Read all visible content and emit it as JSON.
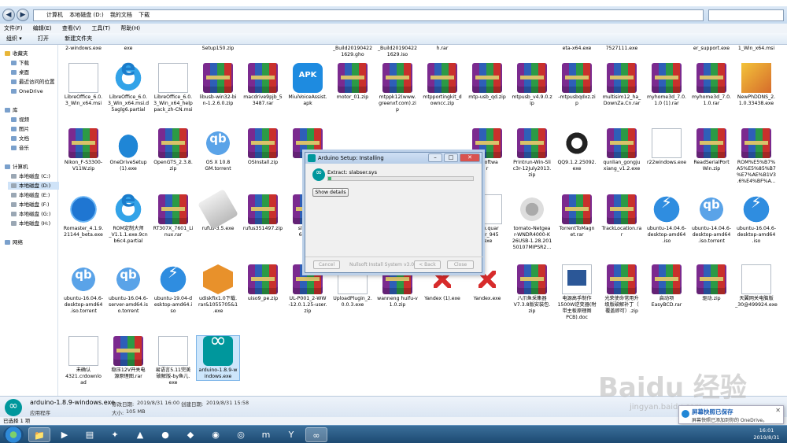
{
  "address": {
    "crumbs": [
      "计算机",
      "本地磁盘 (D:)",
      "我的文档",
      "下载"
    ]
  },
  "menu": [
    "文件(F)",
    "编辑(E)",
    "查看(V)",
    "工具(T)",
    "帮助(H)"
  ],
  "commands": [
    "组织 ▾",
    "打开",
    "新建文件夹"
  ],
  "nav": {
    "favorites_header": "收藏夹",
    "favorites": [
      "下载",
      "桌面",
      "最近访问的位置"
    ],
    "onedrive": "OneDrive",
    "library_header": "库",
    "library": [
      "视频",
      "图片",
      "文档",
      "音乐"
    ],
    "computer_header": "计算机",
    "drives": [
      "本地磁盘 (C:)",
      "本地磁盘 (D:)",
      "本地磁盘 (E:)",
      "本地磁盘 (F:)",
      "本地磁盘 (G:)",
      "本地磁盘 (H:)"
    ],
    "network": "网络"
  },
  "top_row_labels": [
    "2-windows.exe",
    "exe",
    "Setup150.zip",
    "_Build20190422\n1629.gho",
    "_Build20190422\n1629.iso",
    "h.rar",
    "eta-x64.exe",
    "7527111.exe",
    "er_support.exe",
    "1_Win_x64.msi"
  ],
  "files": {
    "row1": [
      "LibreOffice_6.0.\n3_Win_x64.msi",
      "LibreOffice_6.0.\n3_Win_x64.msi.d\n5aglg6.partial",
      "LibreOffice_6.0.\n3_Win_x64_help\npack_zh-CN.msi",
      "libusb-win32-bi\nn-1.2.6.0.zip",
      "macdrive9pjb_5\n3487.rar",
      "MiuiVoiceAssist.\napk",
      "motor_01.zip",
      "mtppk12(www.\ngreenxf.com).zi\np",
      "mtpportingkit_d\nowncc.zip",
      "mtp-usb_qd.zip",
      "mtpusb_v4.9.0.z\nip",
      "-mtpusbqdxz.zi\np",
      "multisim12_ha_\nDownZa.Cn.rar",
      "myhome3d_7.0.\n1.0 (1).rar",
      "myhome3d_7.0.\n1.0.rar",
      "NewPhDDNS_2.\n1.0.33438.exe"
    ],
    "row2": [
      "Nikon_F-S3300-\nV11W.zip",
      "OneDriveSetup\n(1).exe",
      "OpenGTS_2.3.8.\nzip",
      "OS X 10.8\nGM.torrent",
      "OSInstall.zip",
      "PAGr",
      "",
      "",
      "",
      "C-Softwa\nr",
      "Printrun-Win-Sli\nc3r-12July2013.\nzip",
      "QQ9.1.2.25092.\nexe",
      "qunlian_gongju\nxiang_v1.2.exe",
      "r22windows.exe",
      "ReadSerialPort\nWin.zip",
      "ROM%E5%B7%\nA5%E5%85%B7\n%E7%AE%B1V3\n.6%E4%BF%A..."
    ],
    "row3": [
      "Romaster_4.1.9.\n21144_beta.exe",
      "ROM定制大师\n_V1.1.1.exe.9cn\nb6c4.partial",
      "RT307X_7601_Li\nnux.rar",
      "rufus-3.5.exe",
      "rufus351497.zip",
      "slic3r-m\n6-1-2-9\nd",
      "",
      "",
      "",
      "com.quar\nnder_945\n.exe",
      "tomato-Netgea\nr-WNDR4000-K\n26USB-1.28.201\n50107MIPSR2...",
      "TorrentToMagn\net.rar",
      "TrackLocation.ra\nr",
      "ubuntu-14.04.6-\ndesktop-amd64\n.iso",
      "ubuntu-14.04.6-\ndesktop-amd64\n.iso.torrent",
      "ubuntu-16.04.6-\ndesktop-amd64\n.iso"
    ],
    "row4": [
      "ubuntu-16.04.6-\ndesktop-amd64\n.iso.torrent",
      "ubuntu-16.04.6-\nserver-amd64.is\no.torrent",
      "ubuntu-19.04-d\nesktop-amd64.i\nso",
      "udiskfix1.0下载.\nrar&1055705&1\n.exe",
      "uiso9_pe.zip",
      "UL-P001_2-WW\n-12.0.1.25-user.\nzip",
      "UploadPlugin_2.\n0.0.3.exe",
      "wanneng huifu-v\n1.0.zip",
      "Yandex (1).exe",
      "Yandex.exe",
      "八爪鱼采集器\nV7.3.8版安装包.\nzip",
      "电源高手制作\n1500W逆变器(附\n带主板原理图\nPCB).doc",
      "光荣使命常用升\n级版破解补丁（\n覆盖即可）.zip",
      "启动项\nEasyBCD.rar",
      "驱动.zip",
      "天翼网关电脑版\n_30@499924.exe"
    ],
    "row5": [
      "未确认\n4321.crdownlo\nad",
      "稳压12V开关电\n源原理图.rar",
      "易语言5.11完美\n破解版-by鱼儿.\nexe",
      "arduino-1.8.9-w\nindows.exe"
    ]
  },
  "status": {
    "filename": "arduino-1.8.9-windows.exe",
    "type": "应用程序",
    "modified_label": "修改日期:",
    "modified": "2019/8/31 16:00",
    "created_label": "创建日期:",
    "created": "2019/8/31 15:58",
    "size_label": "大小:",
    "size": "105 MB"
  },
  "selected_count": "已选择 1 项",
  "dialog": {
    "title": "Arduino Setup: Installing",
    "extract": "Extract: slabser.sys",
    "progress": 0.02,
    "show_details": "Show details",
    "cancel": "Cancel",
    "nsis": "Nullsoft Install System v3.0",
    "back": "< Back",
    "close": "Close"
  },
  "toast": {
    "title": "屏幕快照已保存",
    "body": "屏幕快照已添加到你的 OneDrive。"
  },
  "clock": {
    "time": "16:01",
    "date": "2019/8/31"
  },
  "watermark": {
    "text": "Baidu 经验",
    "sub": "jingyan.baidu.com"
  }
}
